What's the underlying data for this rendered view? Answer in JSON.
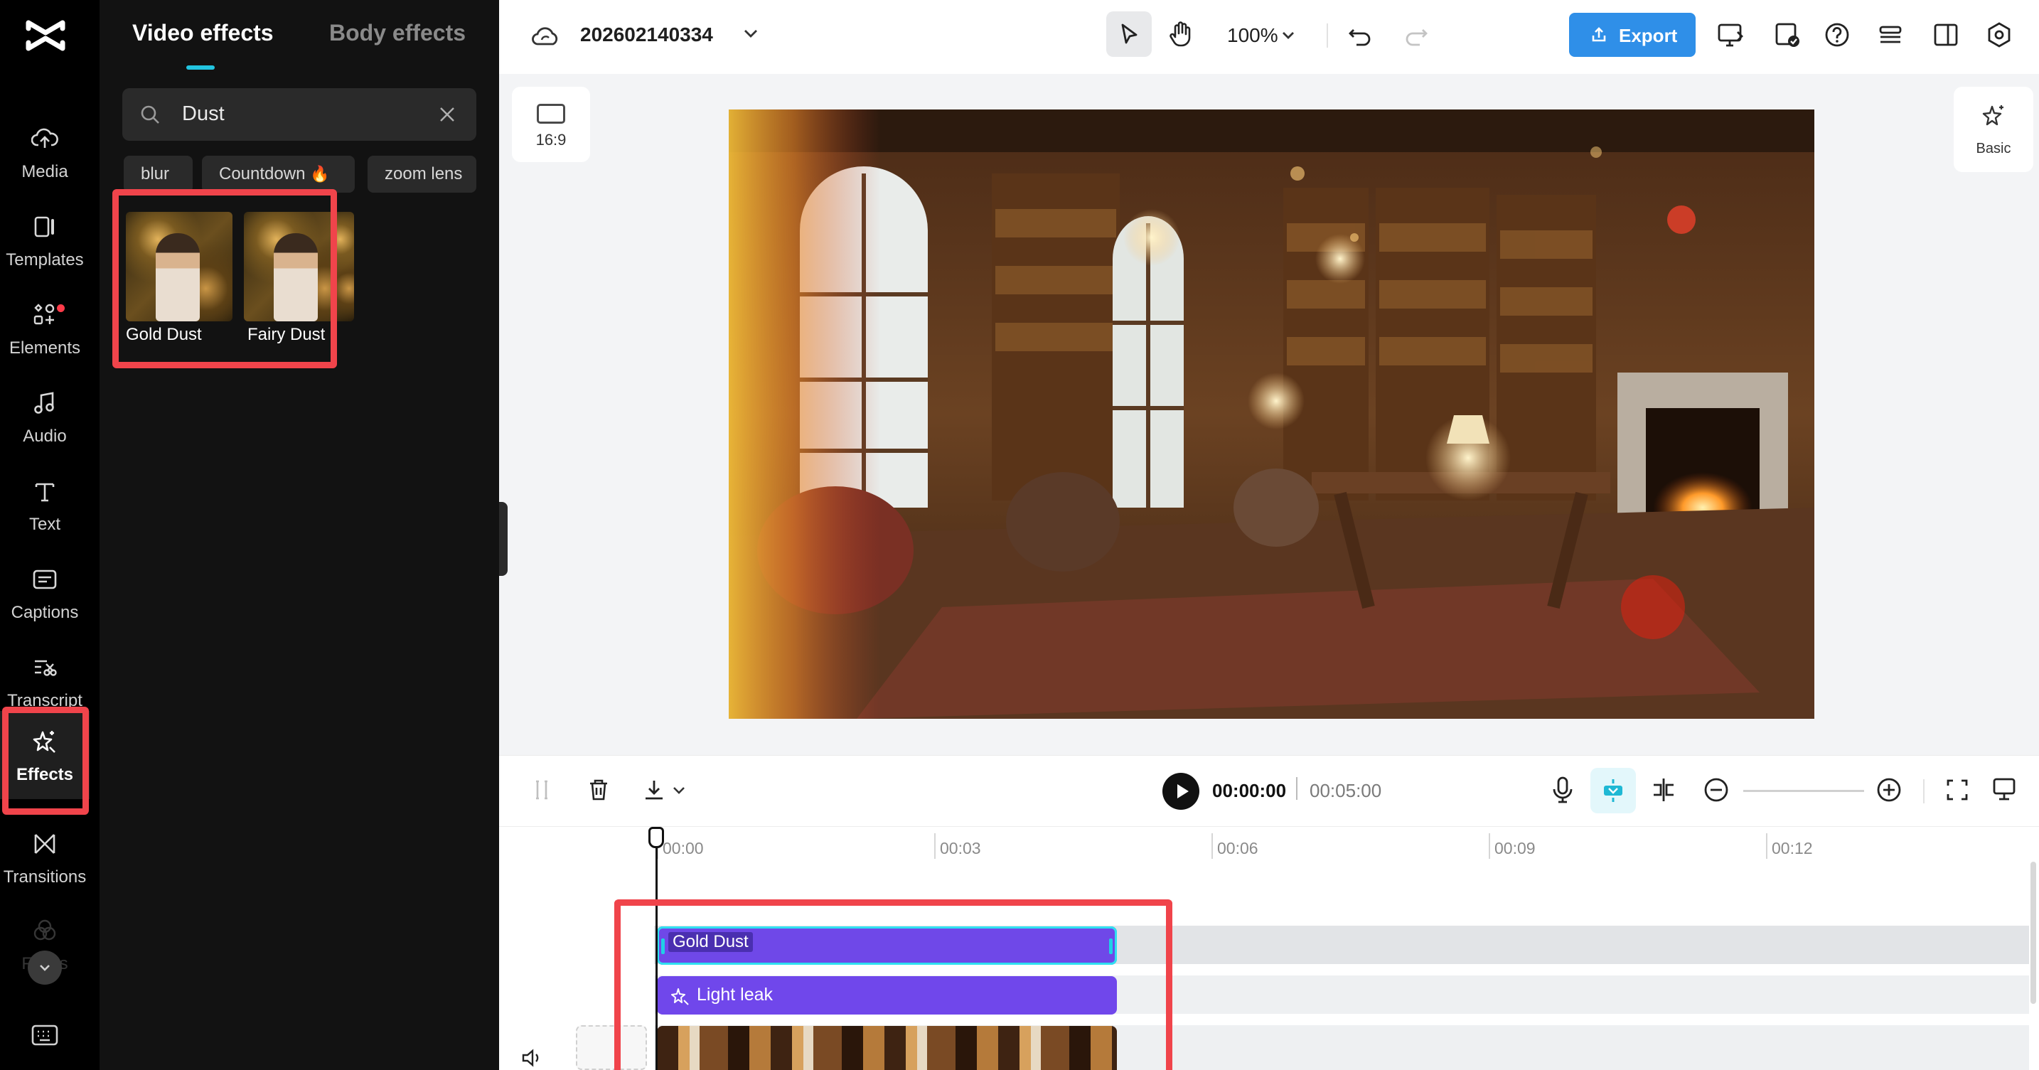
{
  "rail": {
    "items": [
      {
        "label": "Media",
        "icon": "cloud-upload-icon"
      },
      {
        "label": "Templates",
        "icon": "templates-icon"
      },
      {
        "label": "Elements",
        "icon": "elements-icon"
      },
      {
        "label": "Audio",
        "icon": "music-note-icon"
      },
      {
        "label": "Text",
        "icon": "text-T-icon"
      },
      {
        "label": "Captions",
        "icon": "captions-icon"
      },
      {
        "label": "Transcript",
        "icon": "transcript-icon"
      },
      {
        "label": "Effects",
        "icon": "sparkle-star-icon",
        "active": true
      },
      {
        "label": "Transitions",
        "icon": "bowtie-transition-icon"
      },
      {
        "label": "Filters",
        "icon": "filters-circles-icon"
      }
    ]
  },
  "panel": {
    "tabs": [
      {
        "label": "Video effects",
        "active": true
      },
      {
        "label": "Body effects",
        "active": false
      }
    ],
    "search": {
      "value": "Dust"
    },
    "chips": [
      {
        "label": "blur"
      },
      {
        "label": "Countdown",
        "badge": "🔥"
      },
      {
        "label": "zoom lens"
      }
    ],
    "results": [
      {
        "label": "Gold Dust"
      },
      {
        "label": "Fairy Dust"
      }
    ]
  },
  "topbar": {
    "project_name": "202602140334",
    "zoom": "100%",
    "export_label": "Export"
  },
  "canvas": {
    "aspect_ratio": "16:9",
    "basic_label": "Basic"
  },
  "playback": {
    "current_time": "00:00:00",
    "total_time": "00:05:00"
  },
  "timeline": {
    "ticks": [
      "00:00",
      "00:03",
      "00:06",
      "00:09",
      "00:12"
    ],
    "clips": {
      "effect_1": "Gold Dust",
      "effect_2": "Light leak"
    }
  },
  "colors": {
    "accent": "#2f8fe8",
    "highlight_box": "#f0444b",
    "effect_clip": "#7047eb",
    "tab_indicator": "#22c4e0"
  }
}
